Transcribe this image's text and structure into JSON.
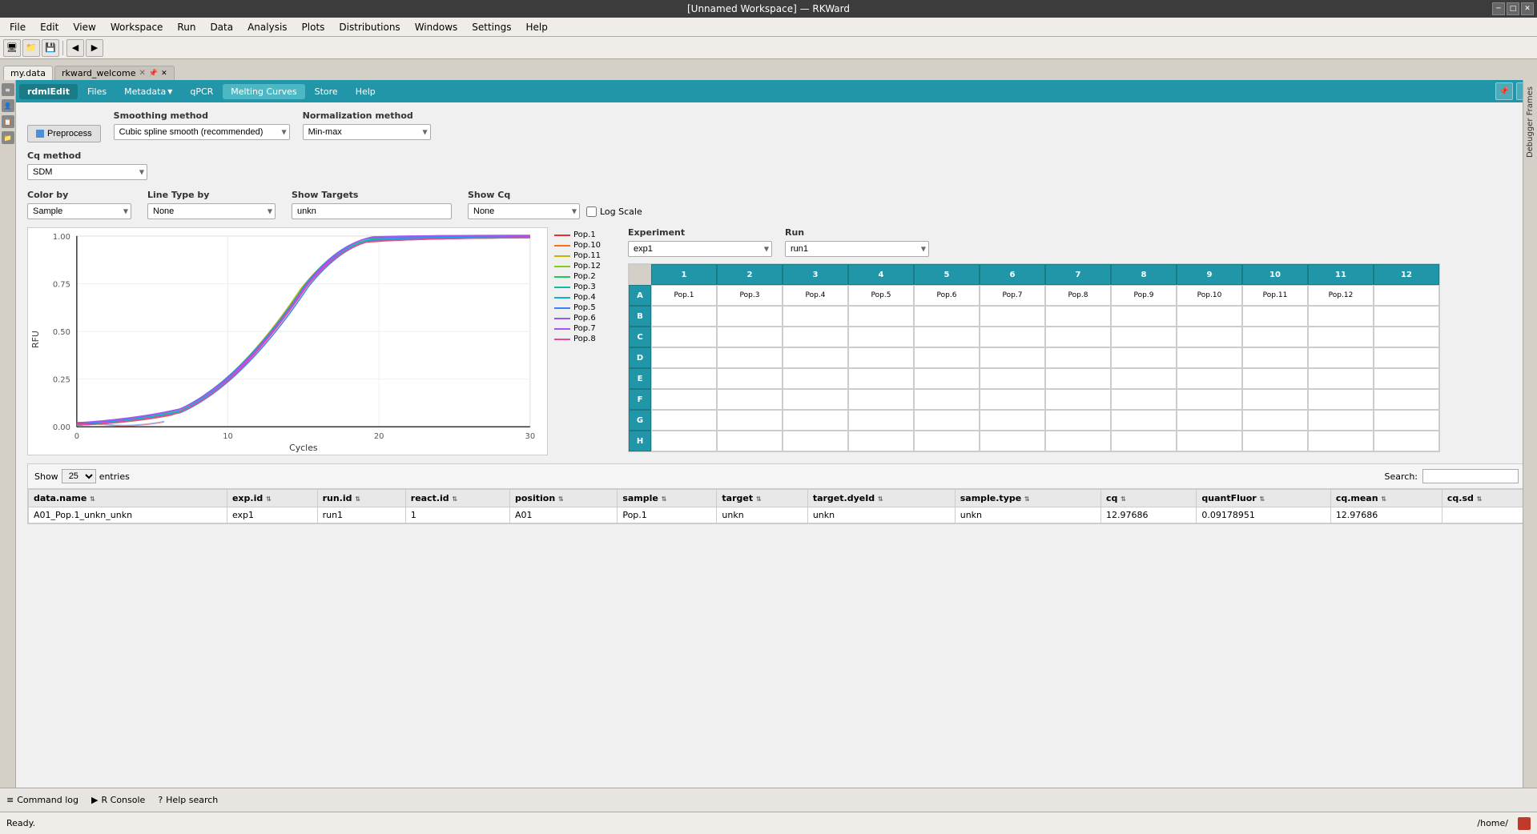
{
  "titlebar": {
    "title": "[Unnamed Workspace] — RKWard"
  },
  "menubar": {
    "items": [
      "File",
      "Edit",
      "View",
      "Workspace",
      "Run",
      "Data",
      "Analysis",
      "Plots",
      "Distributions",
      "Windows",
      "Settings",
      "Help"
    ]
  },
  "filetabs": [
    {
      "label": "my.data",
      "active": true,
      "closeable": false
    },
    {
      "label": "rkward_welcome",
      "active": false,
      "closeable": true
    }
  ],
  "navtabs": {
    "active": "Melting Curves",
    "items": [
      "rdmlEdit",
      "Files",
      "Metadata",
      "qPCR",
      "Melting Curves",
      "Store",
      "Help"
    ]
  },
  "controls": {
    "preprocess_label": "Preprocess",
    "smoothing_method_label": "Smoothing method",
    "smoothing_method_value": "Cubic spline smooth (recommended)",
    "normalization_method_label": "Normalization method",
    "normalization_method_value": "Min-max",
    "cq_method_label": "Cq method",
    "cq_method_value": "SDM",
    "color_by_label": "Color by",
    "color_by_value": "Sample",
    "line_type_label": "Line Type by",
    "line_type_value": "None",
    "show_targets_label": "Show Targets",
    "show_targets_value": "unkn",
    "show_cq_label": "Show Cq",
    "show_cq_value": "None",
    "log_scale_label": "Log Scale"
  },
  "experiment": {
    "label": "Experiment",
    "value": "exp1",
    "run_label": "Run",
    "run_value": "run1"
  },
  "plate": {
    "columns": [
      "1",
      "2",
      "3",
      "4",
      "5",
      "6",
      "7",
      "8",
      "9",
      "10",
      "11",
      "12"
    ],
    "rows": [
      "A",
      "B",
      "C",
      "D",
      "E",
      "F",
      "G",
      "H"
    ],
    "data": {
      "A1": "Pop.1",
      "A2": "Pop.3",
      "A3": "Pop.4",
      "A4": "Pop.5",
      "A5": "Pop.6",
      "A6": "Pop.7",
      "A7": "Pop.8",
      "A8": "Pop.9",
      "A9": "Pop.10",
      "A10": "Pop.11",
      "A11": "Pop.12"
    },
    "filled_cells": [
      "A1",
      "A2",
      "A3",
      "A4",
      "A5",
      "A6",
      "A7",
      "A8",
      "A9",
      "A10",
      "A11",
      "A12"
    ]
  },
  "plate_row_a": [
    "Pop.1",
    "Pop.3",
    "Pop.4",
    "Pop.5",
    "Pop.6",
    "Pop.7",
    "Pop.8",
    "Pop.9",
    "Pop.10",
    "Pop.11",
    "Pop.12",
    ""
  ],
  "table": {
    "show_entries_label": "Show",
    "show_entries_value": "25",
    "entries_label": "entries",
    "search_label": "Search:",
    "search_placeholder": "",
    "columns": [
      "data.name",
      "exp.id",
      "run.id",
      "react.id",
      "position",
      "sample",
      "target",
      "target.dyeId",
      "sample.type",
      "cq",
      "quantFluor",
      "cq.mean",
      "cq.sd"
    ],
    "rows": [
      {
        "data_name": "A01_Pop.1_unkn_unkn",
        "exp_id": "exp1",
        "run_id": "run1",
        "react_id": "1",
        "position": "A01",
        "sample": "Pop.1",
        "target": "unkn",
        "target_dyeId": "unkn",
        "sample_type": "unkn",
        "cq": "12.97686",
        "quantFluor": "0.09178951",
        "cq_mean": "12.97686",
        "cq_sd": ""
      }
    ]
  },
  "legend": [
    {
      "label": "Pop.1",
      "color": "#e8302e"
    },
    {
      "label": "Pop.10",
      "color": "#f97316"
    },
    {
      "label": "Pop.11",
      "color": "#c8b400"
    },
    {
      "label": "Pop.12",
      "color": "#84cc16"
    },
    {
      "label": "Pop.2",
      "color": "#22c55e"
    },
    {
      "label": "Pop.3",
      "color": "#14b8a6"
    },
    {
      "label": "Pop.4",
      "color": "#06b6d4"
    },
    {
      "label": "Pop.5",
      "color": "#3b82f6"
    },
    {
      "label": "Pop.6",
      "color": "#8b5cf6"
    },
    {
      "label": "Pop.7",
      "color": "#a855f7"
    },
    {
      "label": "Pop.8",
      "color": "#ec4899"
    }
  ],
  "plot": {
    "x_label": "Cycles",
    "y_label": "RFU",
    "x_min": 0,
    "x_max": 30,
    "y_min": 0.0,
    "y_max": 1.0,
    "y_ticks": [
      "1.00",
      "0.75",
      "0.50",
      "0.25",
      "0.00"
    ],
    "x_ticks": [
      "0",
      "10",
      "20",
      "30"
    ]
  },
  "statusbar": {
    "status": "Ready.",
    "path": "/home/"
  },
  "bottombar": {
    "command_log": "Command log",
    "r_console": "R Console",
    "help_search": "Help search"
  }
}
